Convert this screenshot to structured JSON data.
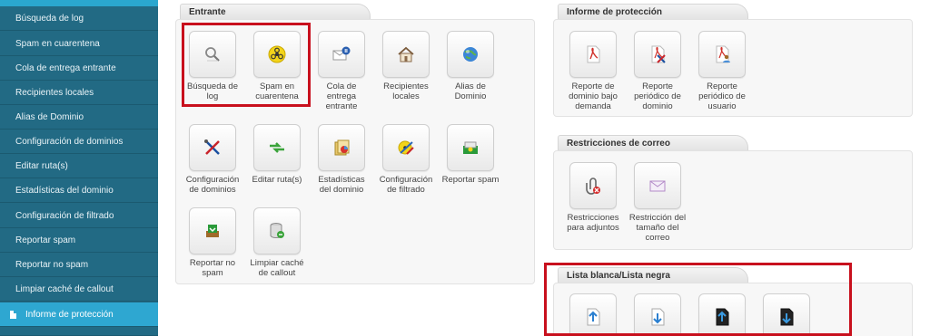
{
  "sidebar": {
    "items": [
      {
        "label": "Búsqueda de log"
      },
      {
        "label": "Spam en cuarentena"
      },
      {
        "label": "Cola de entrega entrante"
      },
      {
        "label": "Recipientes locales"
      },
      {
        "label": "Alias de Dominio"
      },
      {
        "label": "Configuración de dominios"
      },
      {
        "label": "Editar ruta(s)"
      },
      {
        "label": "Estadísticas del dominio"
      },
      {
        "label": "Configuración de filtrado"
      },
      {
        "label": "Reportar spam"
      },
      {
        "label": "Reportar no spam"
      },
      {
        "label": "Limpiar caché de callout"
      },
      {
        "label": "Informe de protección",
        "active": true
      }
    ]
  },
  "panels": {
    "entrante": {
      "title": "Entrante",
      "tiles": [
        {
          "label": "Búsqueda de log",
          "icon": "magnifier-icon"
        },
        {
          "label": "Spam en cuarentena",
          "icon": "biohazard-icon"
        },
        {
          "label": "Cola de entrega entrante",
          "icon": "mail-queue-icon"
        },
        {
          "label": "Recipientes locales",
          "icon": "house-icon"
        },
        {
          "label": "Alias de Dominio",
          "icon": "globe-icon"
        },
        {
          "label": "Configuración de dominios",
          "icon": "tools-icon"
        },
        {
          "label": "Editar ruta(s)",
          "icon": "route-arrows-icon"
        },
        {
          "label": "Estadísticas del dominio",
          "icon": "stats-folder-icon"
        },
        {
          "label": "Configuración de filtrado",
          "icon": "filter-biohazard-icon"
        },
        {
          "label": "Reportar spam",
          "icon": "report-spam-icon"
        },
        {
          "label": "Reportar no spam",
          "icon": "report-nospam-icon"
        },
        {
          "label": "Limpiar caché de callout",
          "icon": "database-clean-icon"
        }
      ]
    },
    "informe": {
      "title": "Informe de protección",
      "tiles": [
        {
          "label": "Reporte de dominio bajo demanda",
          "icon": "pdf-icon"
        },
        {
          "label": "Reporte periódico de dominio",
          "icon": "pdf-x-icon"
        },
        {
          "label": "Reporte periódico de usuario",
          "icon": "pdf-user-icon"
        }
      ]
    },
    "restricciones": {
      "title": "Restricciones de correo",
      "tiles": [
        {
          "label": "Restricciones para adjuntos",
          "icon": "attachment-block-icon"
        },
        {
          "label": "Restricción del tamaño del correo",
          "icon": "envelope-icon"
        }
      ]
    },
    "lista": {
      "title": "Lista blanca/Lista negra",
      "tiles": [
        {
          "label": "",
          "icon": "whitelist-export-icon"
        },
        {
          "label": "",
          "icon": "whitelist-import-icon"
        },
        {
          "label": "",
          "icon": "blacklist-export-icon"
        },
        {
          "label": "",
          "icon": "blacklist-import-icon"
        }
      ]
    }
  },
  "colors": {
    "sidebar_bg": "#226a84",
    "sidebar_active": "#2ea7d1",
    "highlight": "#c8101d"
  }
}
